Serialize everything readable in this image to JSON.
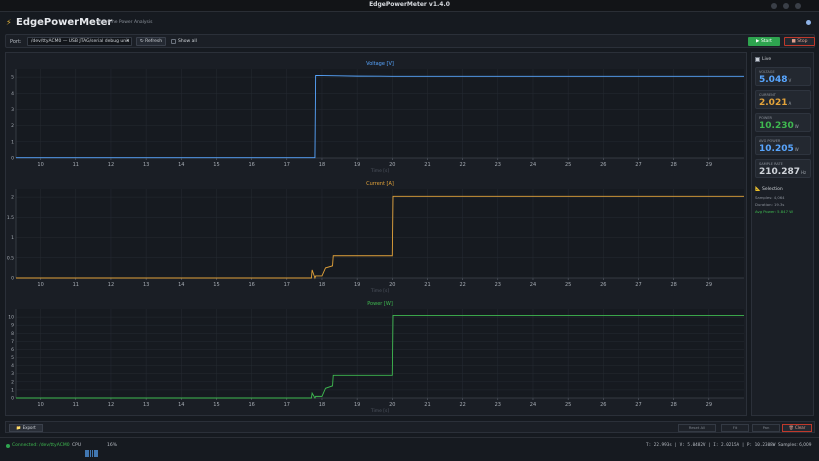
{
  "window": {
    "title": "EdgePowerMeter v1.4.0"
  },
  "header": {
    "title": "EdgePowerMeter",
    "subtitle": "Real-time Power Analysis",
    "bolt_icon": "lightning-icon"
  },
  "toolbar": {
    "port_label": "Port:",
    "port_value": "/dev/ttyACM0 — USB JTAG/serial debug unit",
    "refresh_label": "↻ Refresh",
    "show_all_label": "Show all",
    "start_label": "▶ Start",
    "stop_label": "■ Stop"
  },
  "sidebar": {
    "live_label": "Live",
    "cards": [
      {
        "key": "VOLTAGE",
        "value": "5.048",
        "unit": "V",
        "color": "#58a6ff"
      },
      {
        "key": "CURRENT",
        "value": "2.021",
        "unit": "A",
        "color": "#e3a33a"
      },
      {
        "key": "POWER",
        "value": "10.230",
        "unit": "W",
        "color": "#3fb950"
      },
      {
        "key": "AVG POWER",
        "value": "10.205",
        "unit": "W",
        "color": "#58a6ff"
      },
      {
        "key": "SAMPLE RATE",
        "value": "210.287",
        "unit": "Hz",
        "color": "#d0d4da"
      }
    ],
    "selection_title": "Selection",
    "selection_lines": [
      "Samples: 4,064",
      "Duration: 19.3s",
      "Avg Power: 5.847 W"
    ]
  },
  "bottom": {
    "export_label": "Export",
    "reset_all_label": "Reset All",
    "fit_label": "Fit",
    "pan_label": "Pan",
    "clear_label": "Clear"
  },
  "status": {
    "connected": "Connected: /dev/ttyACM0",
    "cpu_label": "CPU",
    "cpu_pct": "16%",
    "readout": "T: 22.993s | V: 5.0482V | I: 2.0215A | P: 10.2308W",
    "samples": "Samples: 6,009"
  },
  "chart_data": [
    {
      "type": "line",
      "title": "Voltage [V]",
      "xlabel": "Time [s]",
      "color": "#58a6ff",
      "xlim": [
        9.3,
        30.0
      ],
      "ylim": [
        0,
        5.5
      ],
      "x_ticks": [
        10,
        11,
        12,
        13,
        14,
        15,
        16,
        17,
        18,
        19,
        20,
        21,
        22,
        23,
        24,
        25,
        26,
        27,
        28,
        29
      ],
      "y_ticks": [
        0,
        1,
        2,
        3,
        4,
        5
      ],
      "x": [
        9.3,
        17.6,
        17.8,
        17.82,
        18.5,
        19.0,
        20.0,
        30.0
      ],
      "values": [
        0.02,
        0.02,
        0.02,
        5.1,
        5.08,
        5.06,
        5.05,
        5.05
      ]
    },
    {
      "type": "line",
      "title": "Current [A]",
      "xlabel": "Time [s]",
      "color": "#e3a33a",
      "xlim": [
        9.3,
        30.0
      ],
      "ylim": [
        0,
        2.2
      ],
      "x_ticks": [
        10,
        11,
        12,
        13,
        14,
        15,
        16,
        17,
        18,
        19,
        20,
        21,
        22,
        23,
        24,
        25,
        26,
        27,
        28,
        29
      ],
      "y_ticks": [
        0,
        0.5,
        1,
        1.5,
        2
      ],
      "x": [
        9.3,
        17.6,
        17.7,
        17.72,
        17.8,
        17.82,
        18.0,
        18.1,
        18.3,
        18.32,
        20.0,
        20.02,
        30.0
      ],
      "values": [
        0.0,
        0.0,
        0.0,
        0.2,
        0.0,
        0.05,
        0.05,
        0.25,
        0.3,
        0.55,
        0.55,
        2.02,
        2.02
      ]
    },
    {
      "type": "line",
      "title": "Power [W]",
      "xlabel": "Time [s]",
      "color": "#3fb950",
      "xlim": [
        9.3,
        30.0
      ],
      "ylim": [
        0,
        11
      ],
      "x_ticks": [
        10,
        11,
        12,
        13,
        14,
        15,
        16,
        17,
        18,
        19,
        20,
        21,
        22,
        23,
        24,
        25,
        26,
        27,
        28,
        29
      ],
      "y_ticks": [
        0,
        1,
        2,
        3,
        4,
        5,
        6,
        7,
        8,
        9,
        10
      ],
      "x": [
        9.3,
        17.6,
        17.7,
        17.72,
        17.8,
        17.82,
        18.0,
        18.1,
        18.3,
        18.32,
        20.0,
        20.02,
        30.0
      ],
      "values": [
        0.0,
        0.0,
        0.0,
        0.6,
        0.0,
        0.2,
        0.2,
        1.2,
        1.5,
        2.8,
        2.8,
        10.2,
        10.2
      ]
    }
  ]
}
